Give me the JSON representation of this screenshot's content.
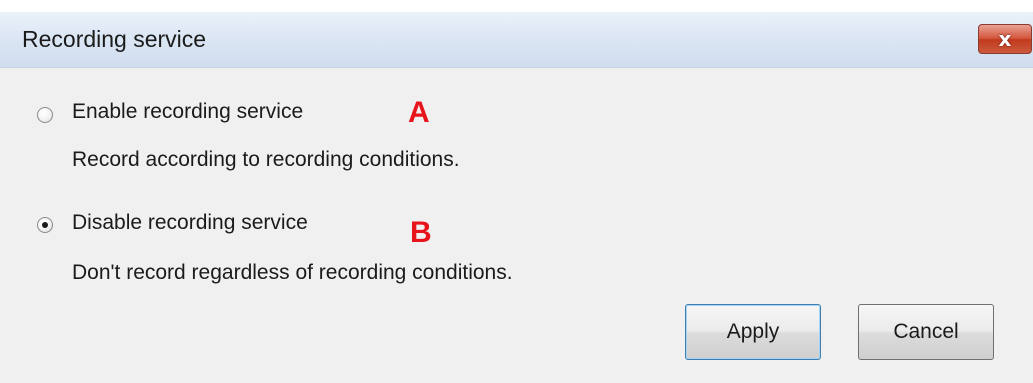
{
  "window": {
    "title": "Recording service",
    "close_glyph": "x"
  },
  "options": [
    {
      "label": "Enable recording service",
      "description": "Record according to recording conditions.",
      "selected": false,
      "marker": "A"
    },
    {
      "label": "Disable recording service",
      "description": "Don't record regardless of recording conditions.",
      "selected": true,
      "marker": "B"
    }
  ],
  "buttons": {
    "apply_label": "Apply",
    "cancel_label": "Cancel"
  },
  "colors": {
    "marker": "#e8141c",
    "dialog_bg": "#f0f0f0",
    "close_button": "#c23a1e"
  }
}
